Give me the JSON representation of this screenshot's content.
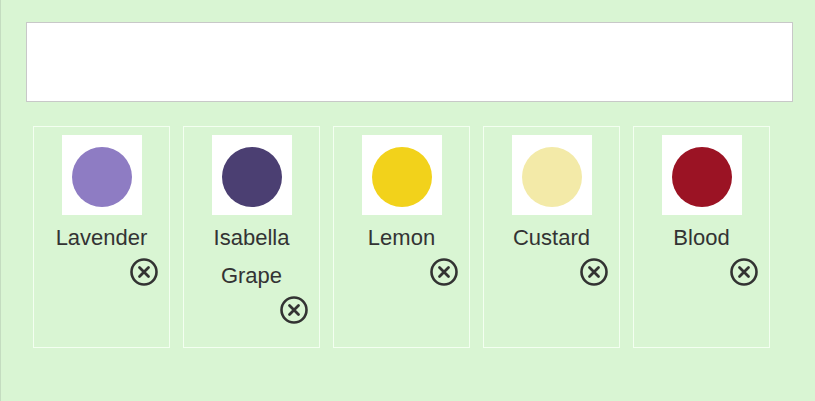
{
  "field": {
    "value": ""
  },
  "tags": [
    {
      "label": "Lavender",
      "color": "#8e7cc3"
    },
    {
      "label": "Isabella Grape",
      "color": "#4b3f72"
    },
    {
      "label": "Lemon",
      "color": "#f2d21b"
    },
    {
      "label": "Custard",
      "color": "#f3eaa8"
    },
    {
      "label": "Blood",
      "color": "#9b1324"
    }
  ]
}
